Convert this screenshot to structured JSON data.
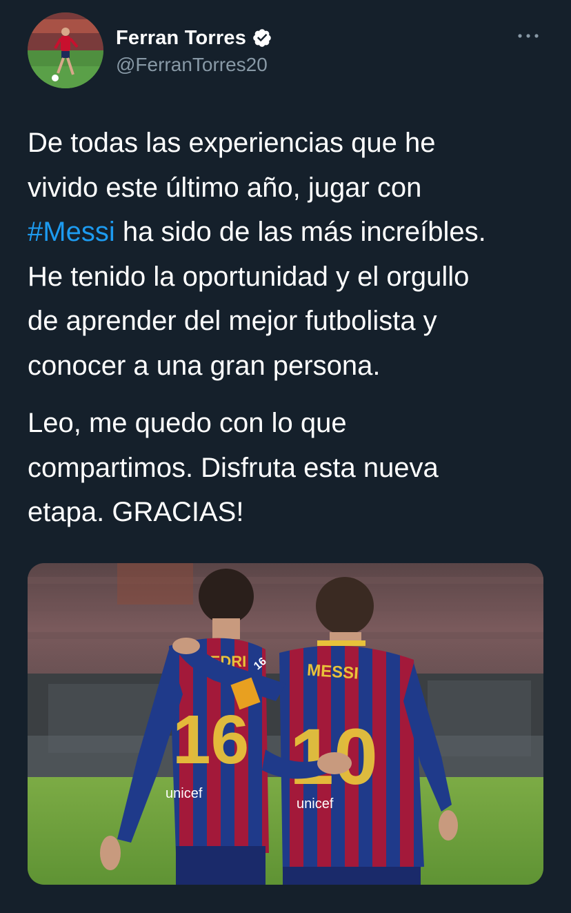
{
  "author": {
    "display_name": "Ferran Torres",
    "handle": "@FerranTorres20",
    "verified": true,
    "avatar_icon": "player-avatar"
  },
  "tweet": {
    "line1": "De todas las experiencias que he",
    "line2": "vivido este último año, jugar con",
    "hashtag": "#Messi",
    "line3_rest": " ha sido de las más increíbles.",
    "line4": "He tenido la oportunidad y el orgullo",
    "line5": "de aprender del mejor futbolista y",
    "line6": "conocer a una gran persona.",
    "para2_line1": "Leo, me quedo con lo que",
    "para2_line2": "compartimos. Disfruta esta nueva",
    "para2_line3": "etapa. GRACIAS!"
  },
  "media": {
    "left_shirt_name": "PEDRI",
    "left_shirt_number": "16",
    "left_sleeve_number": "16",
    "right_shirt_name": "MESSI",
    "right_shirt_number": "10",
    "sponsor": "unicef"
  },
  "colors": {
    "background": "#15202b",
    "text": "#ffffff",
    "secondary": "#8899a6",
    "link": "#1d9bf0",
    "verified_badge": "#ffffff"
  },
  "icons": {
    "verified": "verified-badge-icon",
    "more": "more-options-icon"
  }
}
